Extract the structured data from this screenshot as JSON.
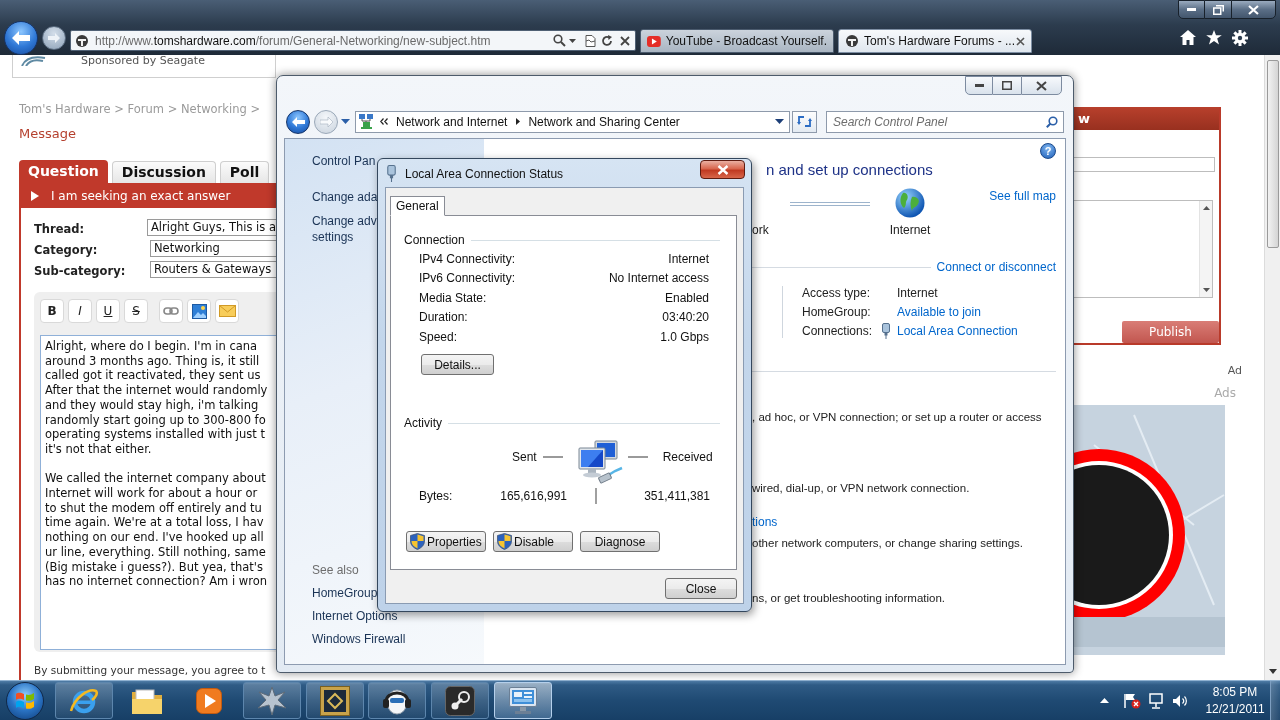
{
  "browser": {
    "address": {
      "prefix": "http://www.",
      "domain": "tomshardware.com",
      "path": "/forum/General-Networking/new-subject.htm"
    },
    "tabs": [
      {
        "kind": "video",
        "label": "YouTube - Broadcast Yourself.",
        "selected": false
      },
      {
        "kind": "forum",
        "label": "Tom's Hardware Forums - ...",
        "selected": true
      }
    ]
  },
  "page": {
    "sponsor": "Sponsored by Seagate",
    "breadcrumb": "Tom's Hardware > Forum > Networking >",
    "heading": "Message",
    "tabs": [
      {
        "label": "Question",
        "selected": true
      },
      {
        "label": "Discussion",
        "selected": false
      },
      {
        "label": "Poll",
        "selected": false
      }
    ],
    "banner": "I am seeking an exact answer",
    "fields": [
      {
        "label": "Thread:",
        "value": "Alright Guys, This is a"
      },
      {
        "label": "Category:",
        "value": "Networking"
      },
      {
        "label": "Sub-category:",
        "value": "Routers & Gateways"
      }
    ],
    "toolbar": [
      {
        "kind": "bold",
        "label": "B"
      },
      {
        "kind": "italic",
        "label": "I"
      },
      {
        "kind": "underline",
        "label": "U"
      },
      {
        "kind": "strike",
        "label": "S"
      },
      {
        "kind": "link"
      },
      {
        "kind": "image"
      },
      {
        "kind": "mail"
      }
    ],
    "message": [
      [
        "Alright, where do I begin. I'm in cana",
        "around 3 months ago. Thing is, it still",
        "called got it reactivated, they sent us",
        "After that the internet would randomly",
        "and they would stay high, i'm talking",
        "randomly start going up to 300-800 fo",
        "operating systems installed with just t",
        "it's not that either."
      ],
      [
        "We called the internet company about",
        "Internet will work for about a hour or",
        "to shut the modem off entirely and tu",
        "time again. We're at a total loss, I hav",
        "nothing on our end. I've hooked up all",
        "ur line, everything. Still nothing, same",
        "(Big mistake i guess?). But yea, that's",
        "has no internet connection? Am i wron"
      ]
    ],
    "terms": "By submitting your message, you agree to t",
    "side_panel": {
      "header": "w",
      "publish": "Publish"
    },
    "ad_label": "Ad",
    "ads_label": "Ads"
  },
  "control_panel": {
    "breadcrumb": [
      "Network and Internet",
      "Network and Sharing Center"
    ],
    "search_placeholder": "Search Control Panel",
    "help": "?",
    "left_links": [
      {
        "lines": [
          "Control Pan"
        ]
      },
      {
        "lines": [
          "Change ada"
        ]
      },
      {
        "lines": [
          "Change adv",
          "settings"
        ]
      }
    ],
    "see_also_title": "See also",
    "see_also": [
      "HomeGroup",
      "Internet Options",
      "Windows Firewall"
    ],
    "title": "n and set up connections",
    "map": {
      "partial_label": "ork",
      "internet_label": "Internet",
      "full_map": "See full map"
    },
    "connect_link": "Connect or disconnect",
    "properties": [
      {
        "label": "Access type:",
        "value": "Internet",
        "kind": "text"
      },
      {
        "label": "HomeGroup:",
        "value": "Available to join",
        "kind": "link"
      },
      {
        "label": "Connections:",
        "value": "Local Area Connection",
        "kind": "connection"
      }
    ],
    "sections": [
      {
        "description": ", ad hoc, or VPN connection; or set up a router or access"
      },
      {
        "description": "wired, dial-up, or VPN network connection."
      },
      {
        "link": "tions",
        "description": "other network computers, or change sharing settings."
      },
      {
        "description": "ns, or get troubleshooting information."
      }
    ]
  },
  "dialog": {
    "title": "Local Area Connection Status",
    "tabs": [
      {
        "label": "General",
        "selected": true
      }
    ],
    "connection_title": "Connection",
    "connection_rows": [
      {
        "label": "IPv4 Connectivity:",
        "value": "Internet"
      },
      {
        "label": "IPv6 Connectivity:",
        "value": "No Internet access"
      },
      {
        "label": "Media State:",
        "value": "Enabled"
      },
      {
        "label": "Duration:",
        "value": "03:40:20"
      },
      {
        "label": "Speed:",
        "value": "1.0 Gbps"
      }
    ],
    "details_button": "Details...",
    "activity_title": "Activity",
    "sent_label": "Sent",
    "received_label": "Received",
    "bytes_label": "Bytes:",
    "bytes_sent": "165,616,991",
    "bytes_received": "351,411,381",
    "buttons": [
      {
        "label": "Properties",
        "shield": true
      },
      {
        "label": "Disable",
        "shield": true
      },
      {
        "label": "Diagnose",
        "shield": false
      }
    ],
    "close_button": "Close"
  },
  "taskbar": {
    "apps": [
      {
        "kind": "browser",
        "running": true,
        "selected": false
      },
      {
        "kind": "folder",
        "running": false,
        "selected": false
      },
      {
        "kind": "media",
        "running": false,
        "selected": false
      },
      {
        "kind": "strategy",
        "running": true,
        "selected": false
      },
      {
        "kind": "arena",
        "running": true,
        "selected": false
      },
      {
        "kind": "voice",
        "running": true,
        "selected": false
      },
      {
        "kind": "store",
        "running": true,
        "selected": false
      },
      {
        "kind": "panel",
        "running": true,
        "selected": true
      }
    ],
    "time": "8:05 PM",
    "date": "12/21/2011"
  }
}
